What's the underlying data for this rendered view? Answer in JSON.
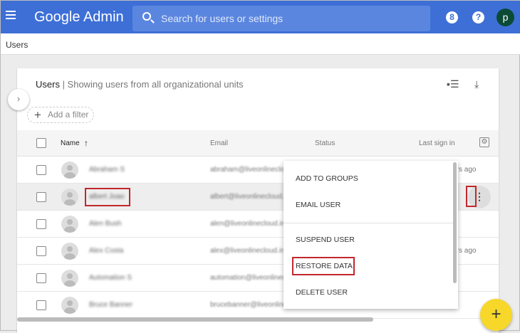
{
  "header": {
    "title": "Google Admin",
    "search_placeholder": "Search for users or settings",
    "hourglass_label": "8",
    "help_label": "?",
    "avatar_letter": "p"
  },
  "breadcrumb": "Users",
  "card": {
    "title": "Users",
    "subtitle": " | Showing users from all organizational units",
    "expand": "›",
    "add_filter": "Add a filter",
    "plus": "+"
  },
  "columns": {
    "name": "Name",
    "sort": "↑",
    "email": "Email",
    "status": "Status",
    "last_sign_in": "Last sign in"
  },
  "rows": [
    {
      "name": "Abraham S",
      "email": "abraham@liveonlinecloud.in",
      "last": "hours ago"
    },
    {
      "name": "albert Joao",
      "email": "albert@liveonlinecloud.in",
      "last": ""
    },
    {
      "name": "Alen Bush",
      "email": "alen@liveonlinecloud.in",
      "last": ""
    },
    {
      "name": "Alex Costa",
      "email": "alex@liveonlinecloud.in",
      "last": "hours ago"
    },
    {
      "name": "Automation S",
      "email": "automation@liveonlinecloud.in",
      "last": ""
    },
    {
      "name": "Bruce Banner",
      "email": "brucebanner@liveonlinecloud.in",
      "last": ""
    }
  ],
  "more_icon": "⋮",
  "menu": [
    "ADD TO GROUPS",
    "EMAIL USER",
    "SUSPEND USER",
    "RESTORE DATA",
    "DELETE USER"
  ],
  "fab": "+",
  "colors": {
    "header": "#3d6fd6",
    "highlight": "#c1272d",
    "fab": "#f6d72a"
  }
}
